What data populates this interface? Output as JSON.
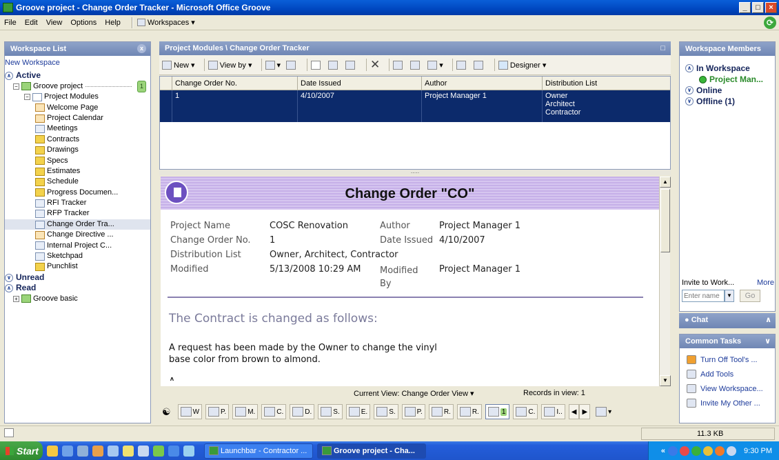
{
  "window": {
    "title": "Groove project - Change Order Tracker - Microsoft Office Groove",
    "btn_min": "_",
    "btn_max": "□",
    "btn_close": "×"
  },
  "menu": {
    "items": [
      "File",
      "Edit",
      "View",
      "Options",
      "Help"
    ],
    "workspaces": "Workspaces ▾"
  },
  "workspace_list": {
    "header": "Workspace List",
    "new_workspace": "New Workspace",
    "active_label": "Active",
    "groove_project": "Groove project",
    "groove_badge": "1",
    "project_modules": "Project Modules",
    "tools": [
      "Welcome Page",
      "Project Calendar",
      "Meetings",
      "Contracts",
      "Drawings",
      "Specs",
      "Estimates",
      "Schedule",
      "Progress Documen...",
      "RFI Tracker",
      "RFP Tracker",
      "Change Order Tra...",
      "Change Directive ...",
      "Internal Project C...",
      "Sketchpad",
      "Punchlist"
    ],
    "unread_label": "Unread",
    "read_label": "Read",
    "groove_basic": "Groove basic"
  },
  "center": {
    "header": "Project Modules \\ Change Order Tracker",
    "toolbar": {
      "new": "New ▾",
      "view_by": "View by ▾",
      "designer": "Designer ▾"
    },
    "grid": {
      "columns": [
        "Change Order No.",
        "Date Issued",
        "Author",
        "Distribution List"
      ],
      "row": {
        "no": "1",
        "date": "4/10/2007",
        "author": "Project Manager 1",
        "dist": "Owner\nArchitect\nContractor"
      }
    },
    "splitter": ".....",
    "form": {
      "title": "Change Order \"CO\"",
      "project_name_label": "Project Name",
      "project_name": "COSC Renovation",
      "author_label": "Author",
      "author": "Project Manager 1",
      "co_no_label": "Change Order No.",
      "co_no": "1",
      "date_issued_label": "Date Issued",
      "date_issued": "4/10/2007",
      "dist_label": "Distribution List",
      "dist": "Owner, Architect, Contractor",
      "modified_label": "Modified",
      "modified": "5/13/2008 10:29 AM",
      "modified_by_label": "Modified By",
      "modified_by": "Project Manager 1",
      "change_heading": "The Contract is changed as follows:",
      "request_text": "A request has been made by the Owner to change the vinyl base color from brown to almond.",
      "next_text_partial": "A ... ... ... ... ... ..."
    },
    "status": {
      "current_view": "Current View: Change Order View ▾",
      "records": "Records in view: 1"
    },
    "tool_tabs": [
      "W",
      "P.",
      "M.",
      "C.",
      "D.",
      "S.",
      "E.",
      "S.",
      "P.",
      "R.",
      "R.",
      "1",
      "C.",
      "I.."
    ]
  },
  "members": {
    "header": "Workspace Members",
    "in_workspace": "In Workspace",
    "member": "Project Man...",
    "online": "Online",
    "offline": "Offline (1)",
    "invite_label": "Invite to Work...",
    "more": "More",
    "enter_name_placeholder": "Enter name",
    "go": "Go"
  },
  "chat": {
    "label": "Chat"
  },
  "common_tasks": {
    "header": "Common Tasks",
    "items": [
      "Turn Off Tool's ...",
      "Add Tools",
      "View Workspace...",
      "Invite My Other ..."
    ]
  },
  "statusbar": {
    "size": "11.3 KB"
  },
  "taskbar": {
    "start": "Start",
    "tasks": [
      "Launchbar - Contractor ...",
      "Groove project - Cha..."
    ],
    "clock": "9:30 PM",
    "tray_chevron": "«"
  },
  "colors": {
    "title_blue": "#0047c0",
    "selection_navy": "#0c2a6b",
    "form_header_purple": "#c6b0e8",
    "panel_header": "#7a8fbc"
  }
}
